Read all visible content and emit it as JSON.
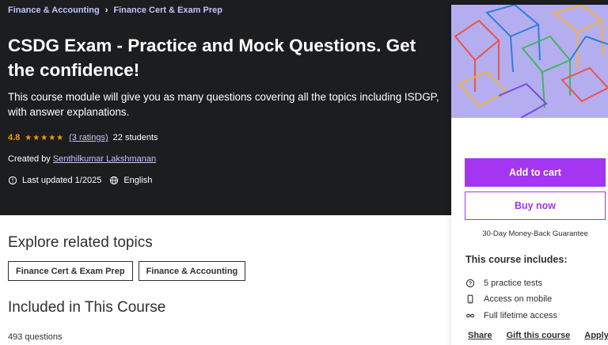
{
  "breadcrumb": [
    {
      "label": "Finance & Accounting"
    },
    {
      "label": "Finance Cert & Exam Prep"
    }
  ],
  "course": {
    "title": "CSDG Exam - Practice and Mock Questions. Get the confidence!",
    "subtitle": "This course module will give you as many questions covering all the topics including ISDGP, with answer explanations.",
    "rating": "4.8",
    "stars": "★★★★★",
    "ratings_count": "(3 ratings)",
    "students": "22 students",
    "created_by_prefix": "Created by",
    "instructor": "Senthilkumar Lakshmanan",
    "last_updated": "Last updated 1/2025",
    "language": "English"
  },
  "related": {
    "title": "Explore related topics",
    "topics": [
      "Finance Cert & Exam Prep",
      "Finance & Accounting"
    ]
  },
  "included": {
    "title": "Included in This Course",
    "count": "493 questions"
  },
  "sidebar": {
    "add_to_cart": "Add to cart",
    "buy_now": "Buy now",
    "guarantee": "30-Day Money-Back Guarantee",
    "includes_title": "This course includes:",
    "items": [
      {
        "icon": "question-circle-icon",
        "label": "5 practice tests"
      },
      {
        "icon": "mobile-icon",
        "label": "Access on mobile"
      },
      {
        "icon": "infinity-icon",
        "label": "Full lifetime access"
      }
    ],
    "actions": [
      "Share",
      "Gift this course",
      "Apply Coupon"
    ]
  },
  "colors": {
    "hero_bg": "#1c1d1f",
    "link_purple": "#c0c4fc",
    "star_orange": "#f69c08",
    "brand_purple": "#a435f0"
  }
}
